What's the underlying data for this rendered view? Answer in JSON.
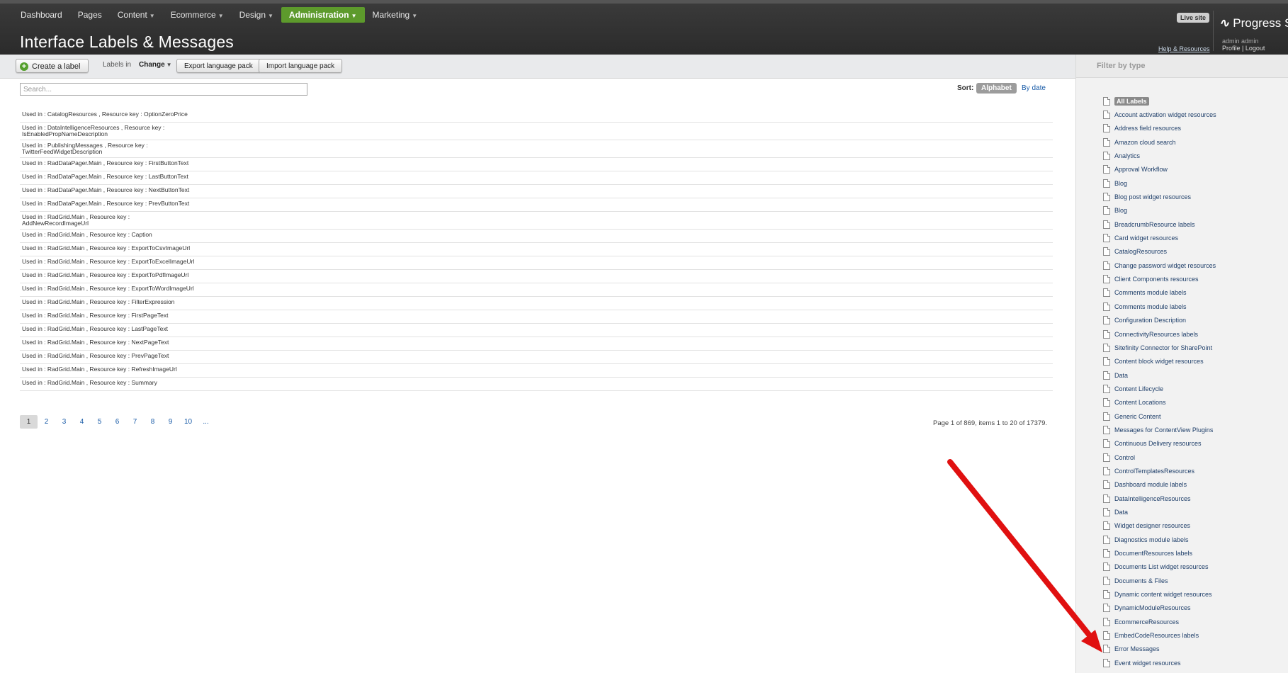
{
  "nav": {
    "items": [
      {
        "label": "Dashboard",
        "has_caret": false,
        "active": false
      },
      {
        "label": "Pages",
        "has_caret": false,
        "active": false
      },
      {
        "label": "Content",
        "has_caret": true,
        "active": false
      },
      {
        "label": "Ecommerce",
        "has_caret": true,
        "active": false
      },
      {
        "label": "Design",
        "has_caret": true,
        "active": false
      },
      {
        "label": "Administration",
        "has_caret": true,
        "active": true
      },
      {
        "label": "Marketing",
        "has_caret": true,
        "active": false
      }
    ],
    "caret_glyph": "▼"
  },
  "header": {
    "title": "Interface Labels & Messages",
    "live_site": "Live site",
    "help_link": "Help & Resources",
    "brand": "Progress Si",
    "user_name": "admin admin",
    "profile_link": "Profile",
    "link_separator": " | ",
    "logout_link": "Logout",
    "accent_color": "#5d9a2c"
  },
  "toolbar": {
    "create_label": "Create a label",
    "labels_in": "Labels in",
    "change": "Change",
    "export": "Export language pack",
    "import": "Import language pack"
  },
  "search": {
    "placeholder": "Search..."
  },
  "sort": {
    "label": "Sort:",
    "alphabet": "Alphabet",
    "by_date": "By date"
  },
  "list": {
    "items": [
      "Used in : CatalogResources , Resource key : OptionZeroPrice",
      "Used in : DataIntelligenceResources , Resource key :\nIsEnabledPropNameDescription",
      "Used in : PublishingMessages , Resource key :\nTwitterFeedWidgetDescription",
      "Used in : RadDataPager.Main , Resource key : FirstButtonText",
      "Used in : RadDataPager.Main , Resource key : LastButtonText",
      "Used in : RadDataPager.Main , Resource key : NextButtonText",
      "Used in : RadDataPager.Main , Resource key : PrevButtonText",
      "Used in : RadGrid.Main , Resource key :\nAddNewRecordImageUrl",
      "Used in : RadGrid.Main , Resource key : Caption",
      "Used in : RadGrid.Main , Resource key : ExportToCsvImageUrl",
      "Used in : RadGrid.Main , Resource key : ExportToExcelImageUrl",
      "Used in : RadGrid.Main , Resource key : ExportToPdfImageUrl",
      "Used in : RadGrid.Main , Resource key : ExportToWordImageUrl",
      "Used in : RadGrid.Main , Resource key : FilterExpression",
      "Used in : RadGrid.Main , Resource key : FirstPageText",
      "Used in : RadGrid.Main , Resource key : LastPageText",
      "Used in : RadGrid.Main , Resource key : NextPageText",
      "Used in : RadGrid.Main , Resource key : PrevPageText",
      "Used in : RadGrid.Main , Resource key : RefreshImageUrl",
      "Used in : RadGrid.Main , Resource key : Summary"
    ]
  },
  "pager": {
    "pages": [
      "1",
      "2",
      "3",
      "4",
      "5",
      "6",
      "7",
      "8",
      "9",
      "10",
      "..."
    ],
    "current": "1",
    "summary": "Page 1 of 869, items 1 to 20 of 17379."
  },
  "sidebar": {
    "title": "Filter by type",
    "items": [
      "All Labels",
      "Account activation widget resources",
      "Address field resources",
      "Amazon cloud search",
      "Analytics",
      "Approval Workflow",
      "Blog",
      "Blog post widget resources",
      "Blog",
      "BreadcrumbResource labels",
      "Card widget resources",
      "CatalogResources",
      "Change password widget resources",
      "Client Components resources",
      "Comments module labels",
      "Comments module labels",
      "Configuration Description",
      "ConnectivityResources labels",
      "Sitefinity Connector for SharePoint",
      "Content block widget resources",
      "Data",
      "Content Lifecycle",
      "Content Locations",
      "Generic Content",
      "Messages for ContentView Plugins",
      "Continuous Delivery resources",
      "Control",
      "ControlTemplatesResources",
      "Dashboard module labels",
      "DataIntelligenceResources",
      "Data",
      "Widget designer resources",
      "Diagnostics module labels",
      "DocumentResources labels",
      "Documents List widget resources",
      "Documents & Files",
      "Dynamic content widget resources",
      "DynamicModuleResources",
      "EcommerceResources",
      "EmbedCodeResources labels",
      "Error Messages",
      "Event widget resources"
    ],
    "selected_index": 0
  },
  "annotation": {
    "arrow_color": "#e01010",
    "target": "Error Messages"
  }
}
